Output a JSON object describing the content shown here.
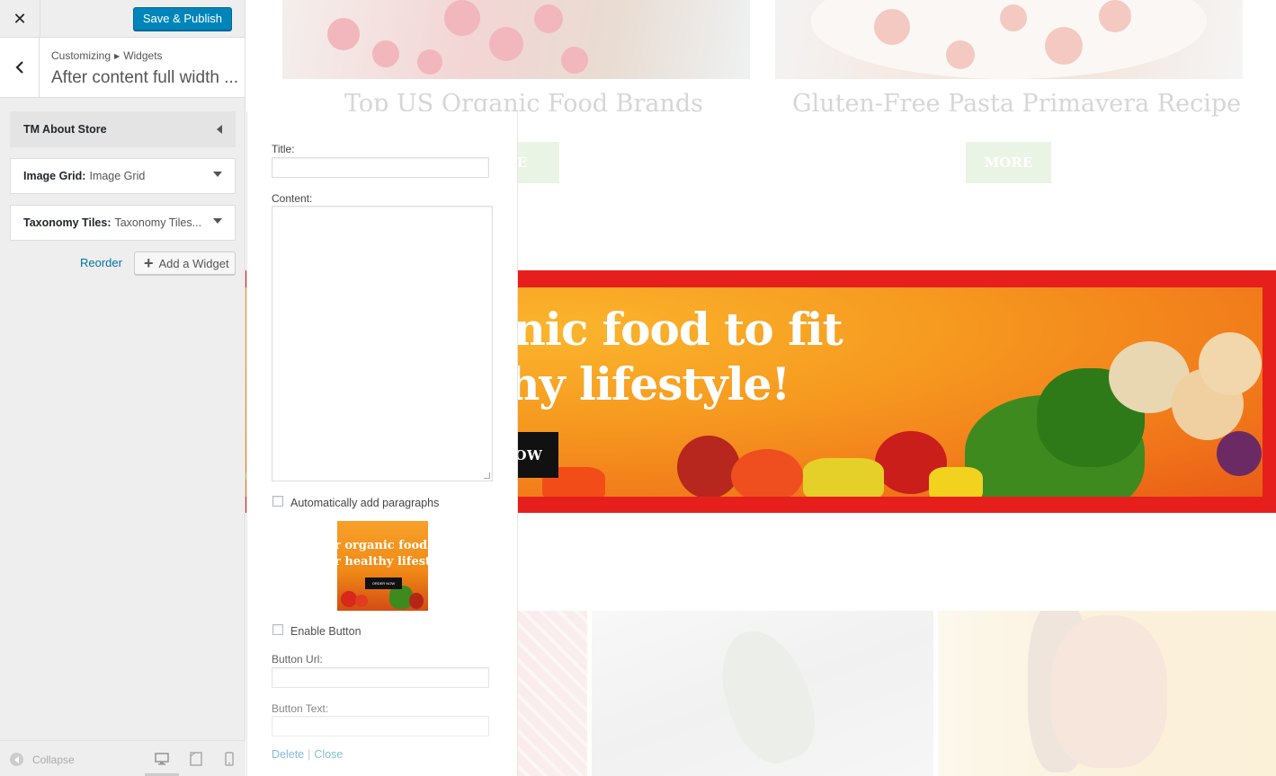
{
  "sidebar": {
    "save_publish_label": "Save & Publish",
    "breadcrumb": {
      "root": "Customizing",
      "child": "Widgets"
    },
    "section_title": "After content full width ...",
    "widgets": [
      {
        "name": "TM About Store",
        "sub": ""
      },
      {
        "name": "Image Grid:",
        "sub": "Image Grid"
      },
      {
        "name": "Taxonomy Tiles:",
        "sub": "Taxonomy Tiles..."
      }
    ],
    "reorder_label": "Reorder",
    "add_widget_label": "Add a Widget",
    "collapse_label": "Collapse"
  },
  "form": {
    "title_label": "Title:",
    "content_label": "Content:",
    "auto_paragraphs_label": "Automatically add paragraphs",
    "thumb_line1": "r organic food",
    "thumb_line2": "r healthy lifest",
    "thumb_button": "ORDER NOW",
    "enable_button_label": "Enable Button",
    "button_url_label": "Button Url:",
    "button_text_label": "Button Text:",
    "delete_label": "Delete",
    "close_label": "Close",
    "separator": "|"
  },
  "preview": {
    "posts": [
      {
        "title": "Top US Organic Food Brands",
        "more": "RE"
      },
      {
        "title": "Gluten-Free Pasta Primavera Recipe",
        "more": "MORE"
      }
    ],
    "banner": {
      "line1": "Order organic food to fit",
      "line2": "your healthy lifestyle!",
      "button": "ORDER NOW"
    }
  },
  "colors": {
    "primary_button": "#0085ba",
    "link": "#0073aa",
    "banner_frame": "#e61f1d",
    "banner_orange": "#f6991f"
  }
}
